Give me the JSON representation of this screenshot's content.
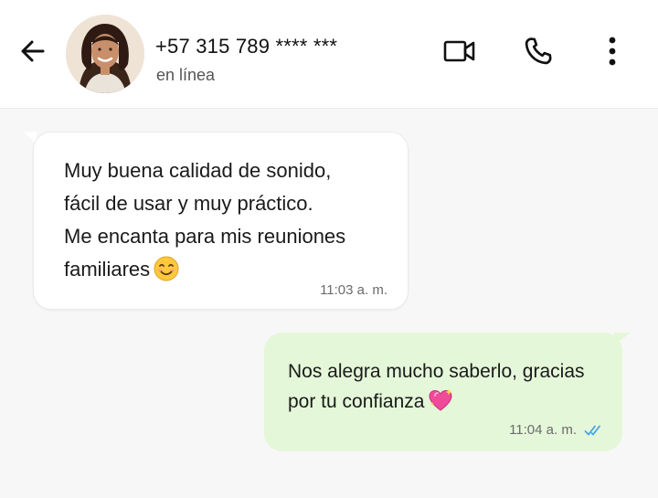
{
  "header": {
    "contact_name": "+57 315 789 **** ***",
    "status": "en línea",
    "back_icon": "arrow-left-icon",
    "video_icon": "video-camera-icon",
    "call_icon": "phone-icon",
    "menu_icon": "more-vertical-icon"
  },
  "messages": [
    {
      "direction": "incoming",
      "lines": [
        "Muy buena calidad de sonido,",
        "fácil de usar y muy práctico.",
        "Me encanta para mis reuniones",
        "familiares"
      ],
      "emoji": "smiling-face-emoji",
      "time": "11:03 a. m."
    },
    {
      "direction": "outgoing",
      "lines": [
        "Nos alegra mucho saberlo, gracias",
        "por tu confianza"
      ],
      "emoji": "sparkling-heart-emoji",
      "time": "11:04 a. m.",
      "status_icon": "double-check-read-icon"
    }
  ],
  "colors": {
    "outgoing_bubble": "#e4f7d9",
    "incoming_bubble": "#ffffff",
    "background": "#f7f7f7",
    "read_check": "#4aa3e8"
  }
}
